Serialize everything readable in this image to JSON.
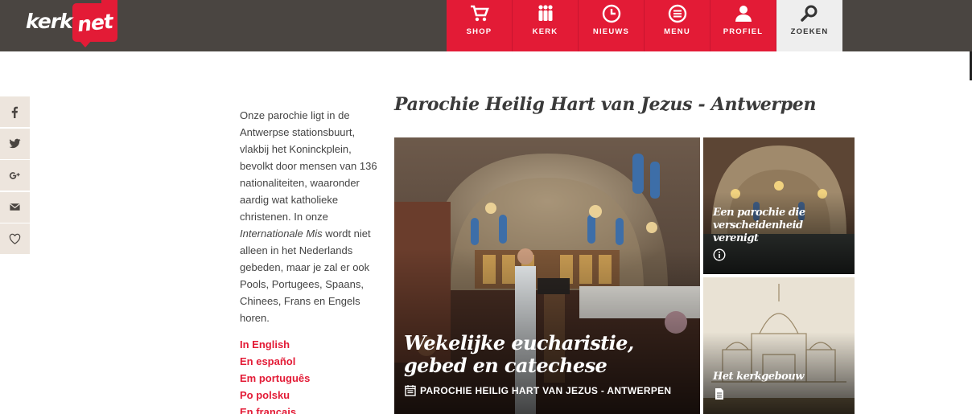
{
  "brand": {
    "logo_text_left": "kerk",
    "logo_text_right": "net",
    "accent": "#e31b36",
    "header_bg": "#4a4541"
  },
  "nav": [
    {
      "label": "SHOP",
      "icon": "cart-icon"
    },
    {
      "label": "KERK",
      "icon": "people-icon"
    },
    {
      "label": "NIEUWS",
      "icon": "clock-icon"
    },
    {
      "label": "MENU",
      "icon": "menu-icon"
    },
    {
      "label": "PROFIEL",
      "icon": "user-icon"
    },
    {
      "label": "ZOEKEN",
      "icon": "search-icon"
    }
  ],
  "social": [
    "facebook-icon",
    "twitter-icon",
    "google-plus-icon",
    "mail-icon",
    "heart-icon"
  ],
  "intro": {
    "text_before": "Onze parochie ligt in de Antwerpse stationsbuurt, vlakbij het Koninckplein, bevolkt door mensen van 136 nationaliteiten, waaronder aardig wat katholieke christenen. In onze ",
    "emphasis": "Internationale Mis",
    "text_after": " wordt niet alleen in het Nederlands gebeden, maar je zal er ook Pools, Portugees, Spaans, Chinees, Frans en Engels horen."
  },
  "languages": [
    "In English",
    "En español",
    "Em português",
    "Po polsku",
    "En français"
  ],
  "page_title": "Parochie Heilig Hart van Jezus - Antwerpen",
  "tiles": {
    "main": {
      "title": "Wekelijke eucharistie, gebed en catechese",
      "meta": "PAROCHIE HEILIG HART VAN JEZUS - ANTWERPEN"
    },
    "side_a": {
      "title": "Een parochie die verscheidenheid verenigt",
      "icon": "info-icon"
    },
    "side_b": {
      "title": "Het kerkgebouw",
      "icon": "document-icon"
    }
  }
}
